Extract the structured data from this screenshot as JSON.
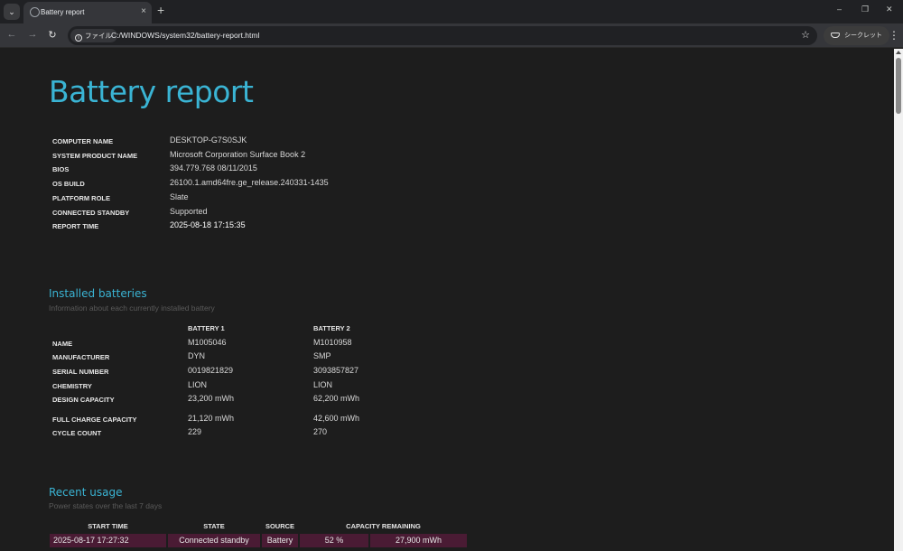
{
  "browser": {
    "tab_title": "Battery report",
    "close_glyph": "×",
    "new_tab_glyph": "+",
    "tab_menu_glyph": "⌄",
    "window": {
      "minimize": "–",
      "restore": "❐",
      "close": "✕"
    },
    "nav": {
      "back": "←",
      "forward": "→",
      "reload": "↻"
    },
    "site_chip_icon": "i",
    "site_chip_label": "ファイル",
    "url": "C:/WINDOWS/system32/battery-report.html",
    "bookmark_glyph": "☆",
    "incognito_label": "シークレット",
    "menu_glyph": "⋮"
  },
  "report": {
    "title": "Battery report",
    "system_info": [
      {
        "label": "COMPUTER NAME",
        "value": "DESKTOP-G7S0SJK"
      },
      {
        "label": "SYSTEM PRODUCT NAME",
        "value": "Microsoft Corporation Surface Book 2"
      },
      {
        "label": "BIOS",
        "value": "394.779.768 08/11/2015"
      },
      {
        "label": "OS BUILD",
        "value": "26100.1.amd64fre.ge_release.240331-1435"
      },
      {
        "label": "PLATFORM ROLE",
        "value": "Slate"
      },
      {
        "label": "CONNECTED STANDBY",
        "value": "Supported"
      },
      {
        "label": "REPORT TIME",
        "value": "2025-08-18   17:15:35"
      }
    ]
  },
  "installed_batteries": {
    "heading": "Installed batteries",
    "subheading": "Information about each currently installed battery",
    "columns": [
      "BATTERY 1",
      "BATTERY 2"
    ],
    "rows": [
      {
        "label": "NAME",
        "values": [
          "M1005046",
          "M1010958"
        ]
      },
      {
        "label": "MANUFACTURER",
        "values": [
          "DYN",
          "SMP"
        ]
      },
      {
        "label": "SERIAL NUMBER",
        "values": [
          "0019821829",
          "3093857827"
        ]
      },
      {
        "label": "CHEMISTRY",
        "values": [
          "LION",
          "LION"
        ]
      },
      {
        "label": "DESIGN CAPACITY",
        "values": [
          "23,200 mWh",
          "62,200 mWh"
        ]
      },
      {
        "label": "FULL CHARGE CAPACITY",
        "values": [
          "21,120 mWh",
          "42,600 mWh"
        ]
      },
      {
        "label": "CYCLE COUNT",
        "values": [
          "229",
          "270"
        ]
      }
    ]
  },
  "recent_usage": {
    "heading": "Recent usage",
    "subheading": "Power states over the last 7 days",
    "columns": [
      "START TIME",
      "STATE",
      "SOURCE",
      "CAPACITY REMAINING"
    ],
    "rows": [
      {
        "start_time": "2025-08-17   17:27:32",
        "state": "Connected standby",
        "source": "Battery",
        "percent": "52 %",
        "mwh": "27,900 mWh"
      }
    ],
    "row_color": "#4a1b34"
  },
  "colors": {
    "accent": "#3ab4d4",
    "background": "#1d1d1d"
  }
}
